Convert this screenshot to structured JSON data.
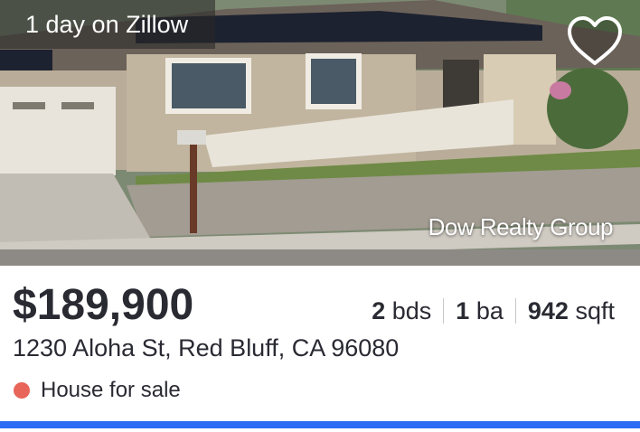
{
  "listing": {
    "days_on_market": "1 day on Zillow",
    "brokerage": "Dow Realty Group",
    "price": "$189,900",
    "beds_value": "2",
    "beds_unit": "bds",
    "baths_value": "1",
    "baths_unit": "ba",
    "sqft_value": "942",
    "sqft_unit": "sqft",
    "address": "1230 Aloha St, Red Bluff, CA 96080",
    "status": "House for sale",
    "favorite_icon": "heart-outline-icon"
  },
  "colors": {
    "status_dot": "#e8655a",
    "accent_bar": "#2a6df4",
    "text": "#2a2a33"
  }
}
